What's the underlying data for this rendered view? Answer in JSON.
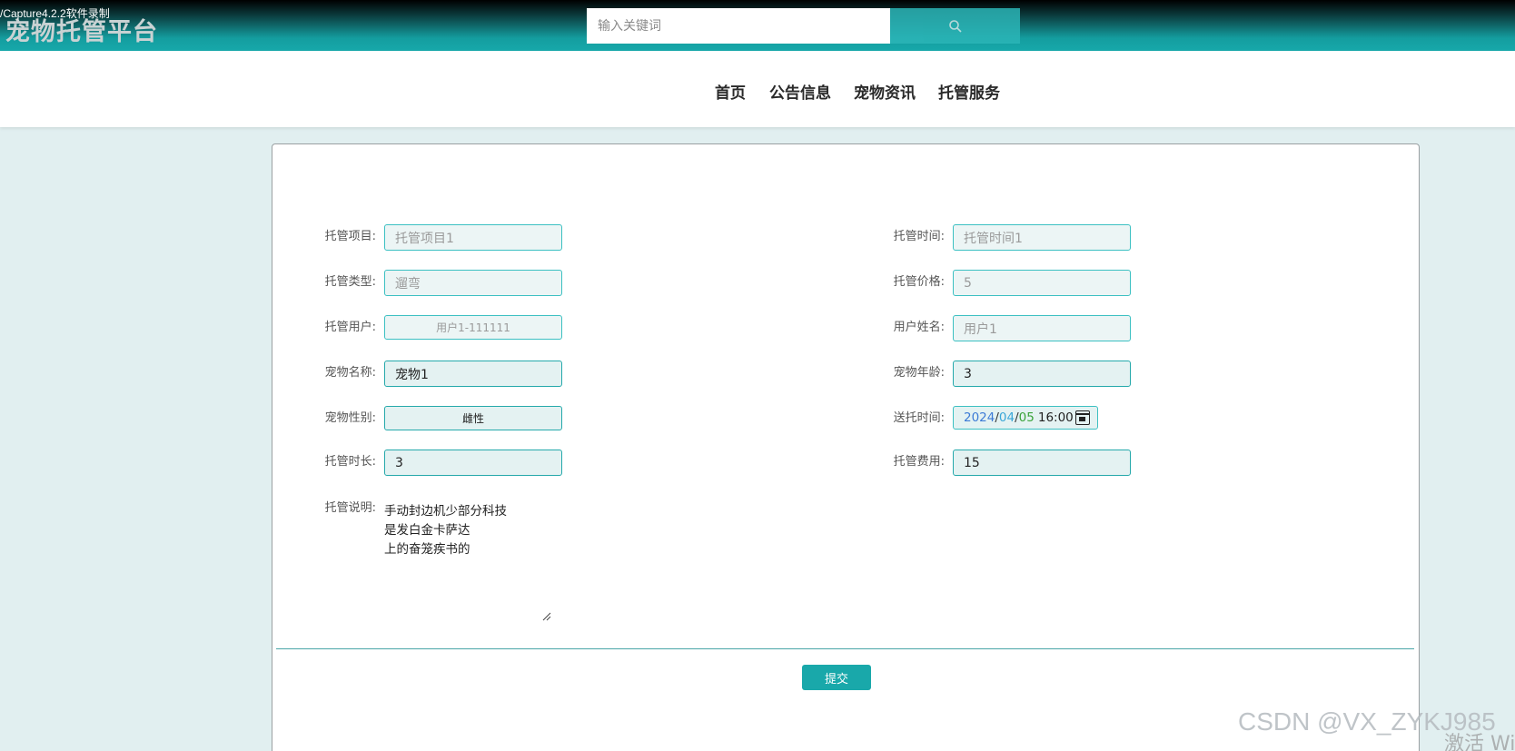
{
  "header": {
    "recorder_watermark": "/Capture4.2.2软件录制",
    "site_title": "宠物托管平台",
    "search": {
      "placeholder": "输入关键词",
      "icon": "search-icon"
    }
  },
  "nav": {
    "items": [
      {
        "label": "首页"
      },
      {
        "label": "公告信息"
      },
      {
        "label": "宠物资讯"
      },
      {
        "label": "托管服务"
      }
    ]
  },
  "form": {
    "left": [
      {
        "label": "托管项目:",
        "value": "托管项目1"
      },
      {
        "label": "托管类型:",
        "value": "遛弯"
      },
      {
        "label": "托管用户:",
        "value": "用户1-111111"
      },
      {
        "label": "宠物名称:",
        "value": "宠物1"
      },
      {
        "label": "宠物性别:",
        "value": "雌性"
      },
      {
        "label": "托管时长:",
        "value": "3"
      }
    ],
    "right": [
      {
        "label": "托管时间:",
        "value": "托管时间1"
      },
      {
        "label": "托管价格:",
        "value": "5"
      },
      {
        "label": "用户姓名:",
        "value": "用户1"
      },
      {
        "label": "宠物年龄:",
        "value": "3"
      },
      {
        "label": "送托时间:",
        "value": ""
      },
      {
        "label": "托管费用:",
        "value": "15"
      }
    ],
    "send_time": {
      "year": "2024",
      "month": "04",
      "day": "05",
      "time": "16:00",
      "sep": "/"
    },
    "description": {
      "label": "托管说明:",
      "lines": [
        "手动封边机少部分科技",
        "是发白金卡萨达",
        "上的奋笼疾书的"
      ]
    },
    "submit_label": "提交"
  },
  "watermarks": {
    "csdn": "CSDN @VX_ZYKJ985",
    "activate": "激活 Wi"
  },
  "colors": {
    "accent": "#19a8aa",
    "field_border": "#3cc0c2",
    "page_bg": "#e1eff0"
  }
}
